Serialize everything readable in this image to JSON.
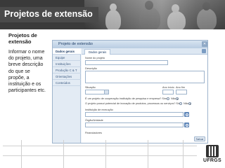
{
  "slide": {
    "title": "Projetos de extensão",
    "left_heading": "Projetos de extensão",
    "left_text": "Informar o nome do projeto, uma breve descrição do que se propõe, a instituição e os participantes etc."
  },
  "window": {
    "title": "Projeto de extensão",
    "close_icon": "close-icon"
  },
  "menu": {
    "items": [
      {
        "label": "Dados gerais",
        "active": true
      },
      {
        "label": "Equipe",
        "active": false
      },
      {
        "label": "Instituições",
        "active": false
      },
      {
        "label": "Produção C & T",
        "active": false
      },
      {
        "label": "Orientações",
        "active": false
      },
      {
        "label": "Conteúdos",
        "active": false
      }
    ]
  },
  "form": {
    "tab_label": "Dados gerais",
    "nome_label": "Nome do projeto",
    "descricao_label": "Descrição",
    "situacao_label": "Situação",
    "ano_inicio_label": "Ano início",
    "ano_fim_label": "Ano fim",
    "cooperacao_question": "É um projeto de cooperação instituição de pesquisa e empresa? Sim",
    "inovacao_question": "O projeto possui potencial de inovação de produtos, processos ou serviços? Sim",
    "sim": "Sim",
    "nao": "Não",
    "instituicao_label": "Instituição de execução",
    "orgao_label": "Órgão/Unidade",
    "save_label": "Salvar",
    "financiadores_label": "Financiadores"
  },
  "logo": {
    "text": "UFRGS"
  }
}
